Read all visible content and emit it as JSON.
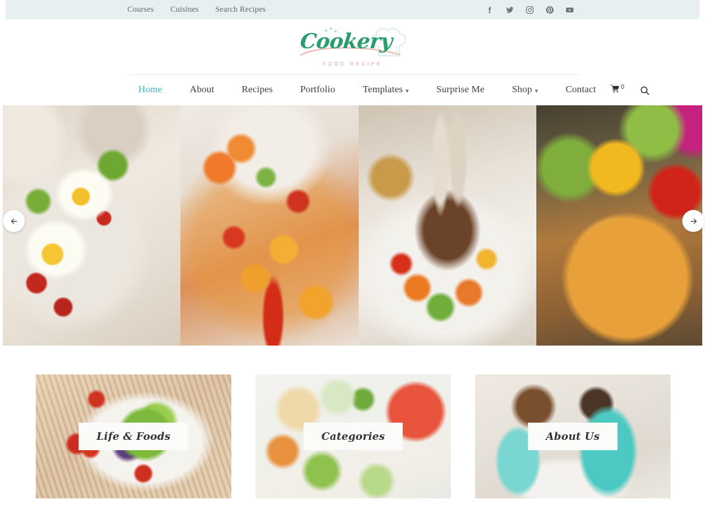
{
  "topbar": {
    "links": [
      {
        "label": "Courses"
      },
      {
        "label": "Cuisines"
      },
      {
        "label": "Search Recipes"
      }
    ],
    "social": [
      {
        "name": "facebook-icon",
        "title": "Facebook"
      },
      {
        "name": "twitter-icon",
        "title": "Twitter"
      },
      {
        "name": "instagram-icon",
        "title": "Instagram"
      },
      {
        "name": "pinterest-icon",
        "title": "Pinterest"
      },
      {
        "name": "youtube-icon",
        "title": "YouTube"
      }
    ],
    "background_color": "#e8eff0"
  },
  "logo": {
    "name": "Cookery",
    "tagline": "FOOD RECIPE",
    "name_color": "#2a9d6e",
    "tagline_color": "#e8a39a",
    "hat_color": "#dfeef0",
    "swoosh_color": "#f0b6ad"
  },
  "nav": {
    "items": [
      {
        "label": "Home",
        "active": true,
        "has_dropdown": false
      },
      {
        "label": "About",
        "active": false,
        "has_dropdown": false
      },
      {
        "label": "Recipes",
        "active": false,
        "has_dropdown": false
      },
      {
        "label": "Portfolio",
        "active": false,
        "has_dropdown": false
      },
      {
        "label": "Templates",
        "active": false,
        "has_dropdown": true
      },
      {
        "label": "Surprise Me",
        "active": false,
        "has_dropdown": false
      },
      {
        "label": "Shop",
        "active": false,
        "has_dropdown": true
      },
      {
        "label": "Contact",
        "active": false,
        "has_dropdown": false
      }
    ],
    "active_color": "#3cb5c4",
    "text_color": "#3c3c3c",
    "cart": {
      "icon": "shopping-cart-icon",
      "count": "0"
    },
    "search": {
      "icon": "search-icon"
    }
  },
  "carousel": {
    "prev_label": "←",
    "next_label": "→",
    "slides": [
      {
        "name": "slide-avocado-toast-eggs",
        "alt": "Avocado toast with fried eggs and tomatoes"
      },
      {
        "name": "slide-baked-casserole",
        "alt": "Baked vegetable and chicken casserole in glass dish"
      },
      {
        "name": "slide-lamb-chops",
        "alt": "Grilled lamb chops with roasted vegetables"
      },
      {
        "name": "slide-pizza-peppers",
        "alt": "Pizza with fresh bell peppers and vegetables"
      }
    ]
  },
  "features": {
    "cards": [
      {
        "label": "Life & Foods",
        "image_name": "card-image-life-and-foods",
        "alt": "Fresh garden salad on bamboo mat"
      },
      {
        "label": "Categories",
        "image_name": "card-image-categories",
        "alt": "Assorted fresh fruit and vegetable plates"
      },
      {
        "label": "About Us",
        "image_name": "card-image-about-us",
        "alt": "Couple cooking together in kitchen"
      }
    ],
    "label_bg": "#fbfbf9",
    "label_color": "#333333"
  }
}
